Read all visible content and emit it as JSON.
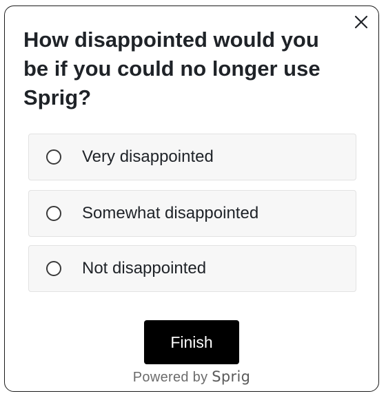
{
  "survey": {
    "question": "How disappointed would you be if you could no longer use Sprig?",
    "options": [
      {
        "label": "Very disappointed",
        "selected": false
      },
      {
        "label": "Somewhat disappointed",
        "selected": false
      },
      {
        "label": "Not disappointed",
        "selected": false
      }
    ],
    "finish_label": "Finish",
    "powered_by_prefix": "Powered by",
    "brand_name": "Sprig",
    "close_icon": "close-icon"
  },
  "colors": {
    "button_bg": "#000000",
    "button_text": "#ffffff",
    "option_bg": "#f7f7f7",
    "option_border": "#e2e2e2",
    "card_border": "#1a1a1a"
  }
}
